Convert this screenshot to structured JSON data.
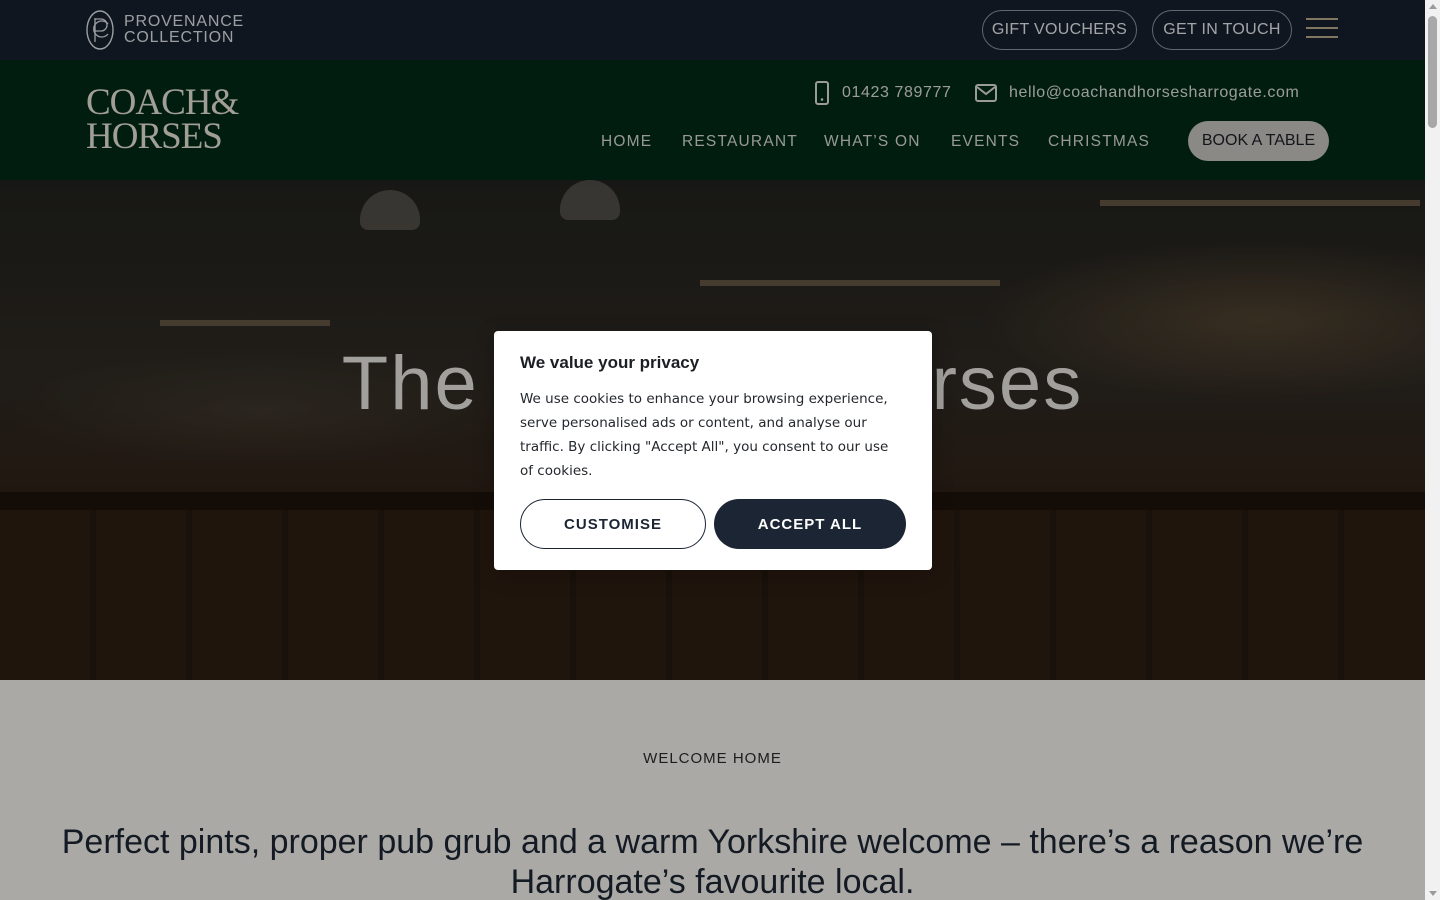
{
  "topbar": {
    "brand_line1": "PROVENANCE",
    "brand_line2": "COLLECTION",
    "gift_vouchers": "GIFT VOUCHERS",
    "get_in_touch": "GET IN TOUCH"
  },
  "header": {
    "logo_line1": "COACH&",
    "logo_line2": "HORSES",
    "phone": "01423 789777",
    "email": "hello@coachandhorsesharrogate.com",
    "nav": [
      "HOME",
      "RESTAURANT",
      "WHAT’S ON",
      "EVENTS",
      "CHRISTMAS"
    ],
    "book_table": "BOOK A TABLE"
  },
  "hero": {
    "title": "The Coach & Horses"
  },
  "content": {
    "eyebrow": "WELCOME HOME",
    "tagline": "Perfect pints, proper pub grub and a warm Yorkshire welcome – there’s a reason we’re Harrogate’s favourite local."
  },
  "cookie": {
    "title": "We value your privacy",
    "body": "We use cookies to enhance your browsing experience, serve personalised ads or content, and analyse our traffic. By clicking \"Accept All\", you consent to our use of cookies.",
    "customise": "CUSTOMISE",
    "accept_all": "ACCEPT ALL"
  },
  "colors": {
    "topbar_bg": "#18202d",
    "header_bg": "#022a18",
    "accent_navy": "#1b2534"
  }
}
